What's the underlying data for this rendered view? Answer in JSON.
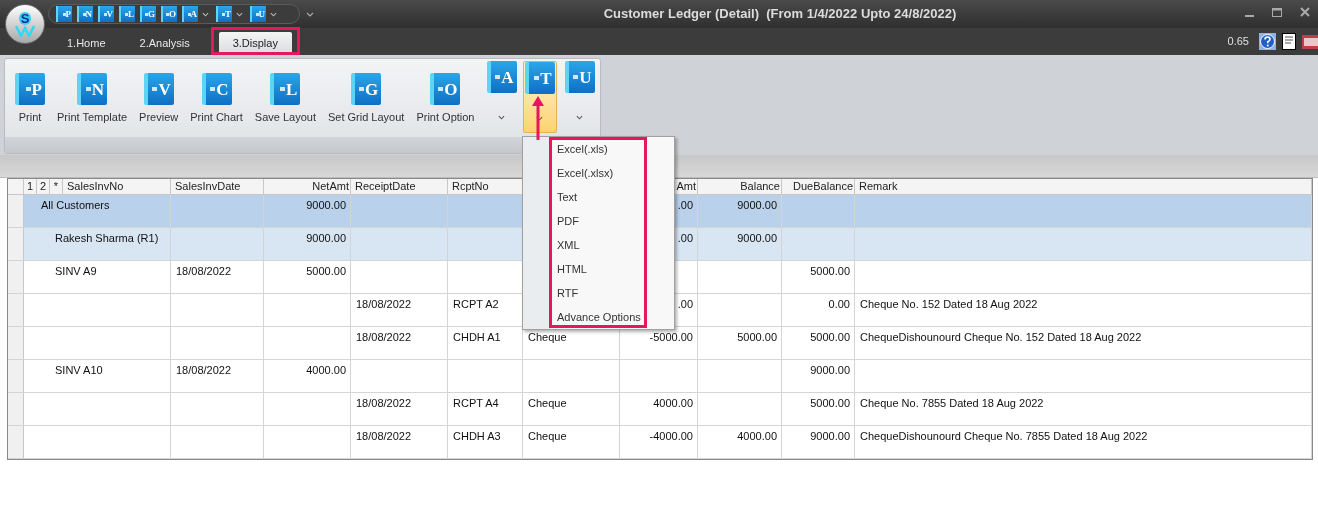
{
  "window": {
    "title": "Customer Ledger (Detail)  (From 1/4/2022 Upto 24/8/2022)",
    "logo_letter": "S"
  },
  "quick_access": [
    {
      "letter": "P",
      "dropdown": false
    },
    {
      "letter": "N",
      "dropdown": false
    },
    {
      "letter": "V",
      "dropdown": false
    },
    {
      "letter": "L",
      "dropdown": false
    },
    {
      "letter": "G",
      "dropdown": false
    },
    {
      "letter": "O",
      "dropdown": false
    },
    {
      "letter": "A",
      "dropdown": true
    },
    {
      "letter": "T",
      "dropdown": true
    },
    {
      "letter": "U",
      "dropdown": true
    }
  ],
  "tabs": [
    {
      "label": "1.Home",
      "selected": false
    },
    {
      "label": "2.Analysis",
      "selected": false
    },
    {
      "label": "3.Display",
      "selected": true
    }
  ],
  "zoom_value": "0.65",
  "ribbon": [
    {
      "kind": "large",
      "letter": "P",
      "label": "Print",
      "pressed": false
    },
    {
      "kind": "large",
      "letter": "N",
      "label": "Print Template",
      "pressed": false
    },
    {
      "kind": "large",
      "letter": "V",
      "label": "Preview",
      "pressed": false
    },
    {
      "kind": "large",
      "letter": "C",
      "label": "Print Chart",
      "pressed": false
    },
    {
      "kind": "large",
      "letter": "L",
      "label": "Save Layout",
      "pressed": false
    },
    {
      "kind": "large",
      "letter": "G",
      "label": "Set Grid Layout",
      "pressed": false
    },
    {
      "kind": "large",
      "letter": "O",
      "label": "Print Option",
      "pressed": false
    },
    {
      "kind": "split",
      "letter": "A",
      "pressed": false
    },
    {
      "kind": "split",
      "letter": "T",
      "pressed": true
    },
    {
      "kind": "split",
      "letter": "U",
      "pressed": false
    }
  ],
  "export_menu": {
    "items": [
      "Excel(.xls)",
      "Excel(.xlsx)",
      "Text",
      "PDF",
      "XML",
      "HTML",
      "RTF",
      "Advance Options"
    ]
  },
  "table": {
    "outline_buttons": [
      "1",
      "2",
      "*"
    ],
    "columns": [
      {
        "label": "SalesInvNo",
        "kind": "text"
      },
      {
        "label": "SalesInvDate",
        "kind": "text"
      },
      {
        "label": "NetAmt",
        "kind": "amount"
      },
      {
        "label": "ReceiptDate",
        "kind": "text"
      },
      {
        "label": "RcptNo",
        "kind": "text"
      },
      {
        "kind": "text"
      },
      {
        "label": "Amt",
        "kind": "amount"
      },
      {
        "label": "Balance",
        "kind": "amount"
      },
      {
        "label": "DueBalance",
        "kind": "amount"
      },
      {
        "label": "Remark",
        "kind": "text"
      }
    ],
    "rows": [
      {
        "kind": "group",
        "cells": [
          "All Customers",
          "",
          "9000.00",
          "",
          "",
          "",
          ".00",
          "9000.00",
          "",
          ""
        ]
      },
      {
        "kind": "subgroup",
        "cells": [
          "Rakesh Sharma (R1)",
          "",
          "9000.00",
          "",
          "",
          "",
          ".00",
          "9000.00",
          "",
          ""
        ]
      },
      {
        "kind": "detail",
        "cells": [
          "SINV A9",
          "18/08/2022",
          "5000.00",
          "",
          "",
          "",
          "",
          "",
          "5000.00",
          ""
        ]
      },
      {
        "kind": "detail",
        "cells": [
          "",
          "",
          "",
          "18/08/2022",
          "RCPT A2",
          "",
          ".00",
          "",
          "0.00",
          "Cheque No. 152 Dated 18 Aug 2022"
        ]
      },
      {
        "kind": "detail",
        "cells": [
          "",
          "",
          "",
          "18/08/2022",
          "CHDH A1",
          "Cheque",
          "-5000.00",
          "5000.00",
          "5000.00",
          "ChequeDishounourd Cheque No. 152 Dated 18 Aug 2022"
        ]
      },
      {
        "kind": "detail",
        "cells": [
          "SINV A10",
          "18/08/2022",
          "4000.00",
          "",
          "",
          "",
          "",
          "",
          "9000.00",
          ""
        ]
      },
      {
        "kind": "detail",
        "cells": [
          "",
          "",
          "",
          "18/08/2022",
          "RCPT A4",
          "Cheque",
          "4000.00",
          "",
          "5000.00",
          "Cheque No. 7855 Dated 18 Aug 2022"
        ]
      },
      {
        "kind": "detail",
        "cells": [
          "",
          "",
          "",
          "18/08/2022",
          "CHDH A3",
          "Cheque",
          "-4000.00",
          "4000.00",
          "9000.00",
          "ChequeDishounourd Cheque No. 7855 Dated 18 Aug 2022"
        ]
      }
    ]
  }
}
